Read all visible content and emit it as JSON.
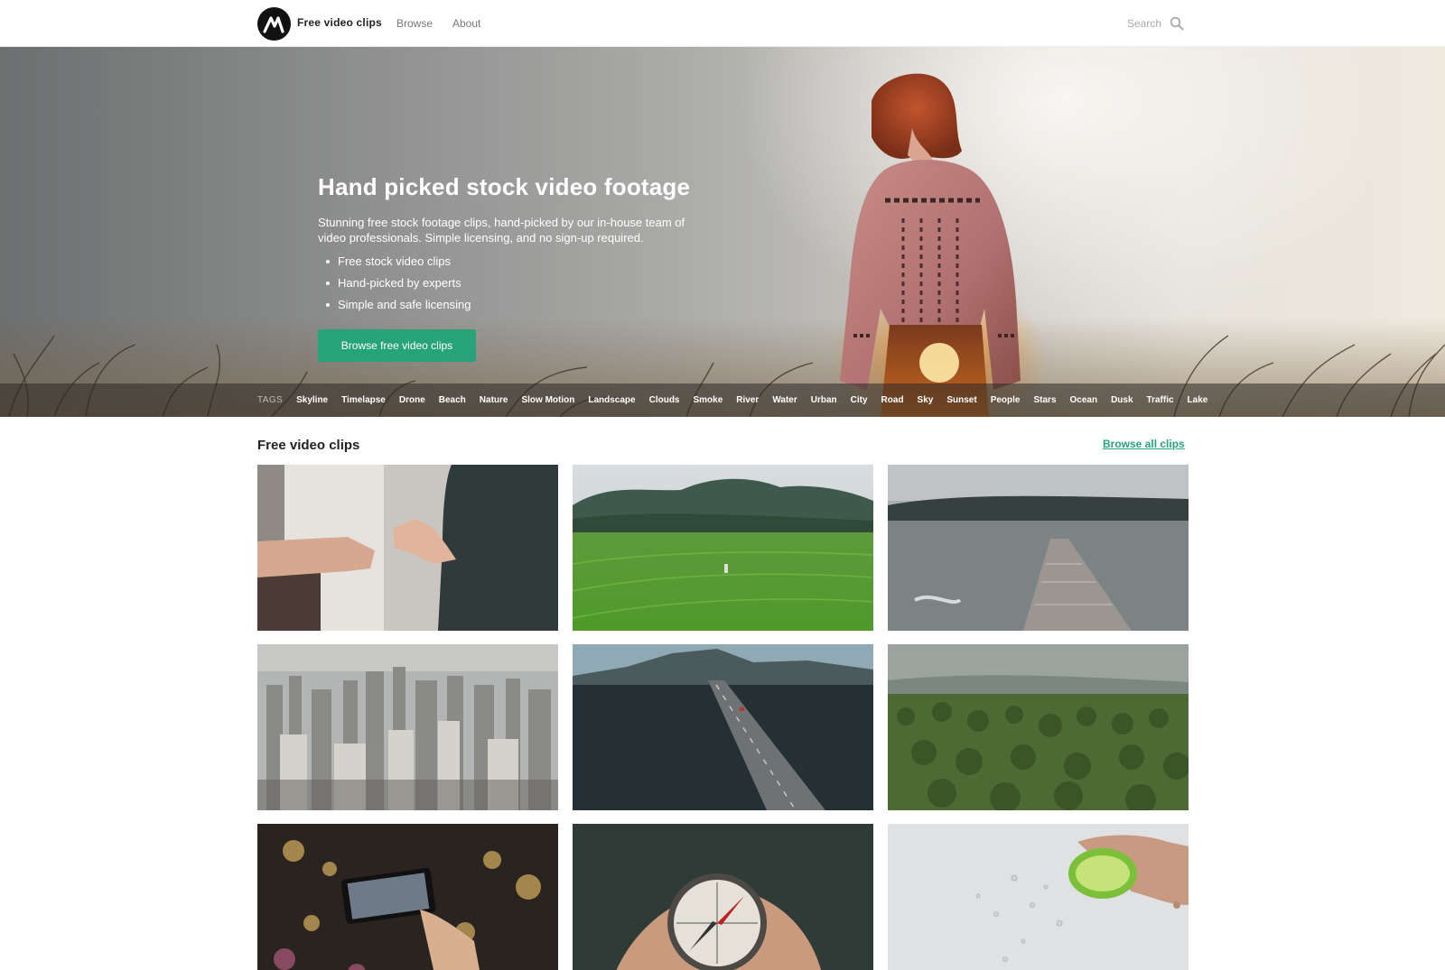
{
  "header": {
    "brand": "Free video clips",
    "nav": [
      {
        "label": "Browse"
      },
      {
        "label": "About"
      }
    ],
    "search_placeholder": "Search"
  },
  "hero": {
    "title": "Hand picked stock video footage",
    "description": "Stunning free stock footage clips, hand-picked by our in-house team of video professionals. Simple licensing, and no sign-up required.",
    "bullets": [
      "Free stock video clips",
      "Hand-picked by experts",
      "Simple and safe licensing"
    ],
    "cta_label": "Browse free video clips"
  },
  "tags": {
    "label": "TAGS",
    "items": [
      "Skyline",
      "Timelapse",
      "Drone",
      "Beach",
      "Nature",
      "Slow Motion",
      "Landscape",
      "Clouds",
      "Smoke",
      "River",
      "Water",
      "Urban",
      "City",
      "Road",
      "Sky",
      "Sunset",
      "People",
      "Stars",
      "Ocean",
      "Dusk",
      "Traffic",
      "Lake"
    ]
  },
  "clips": {
    "title": "Free video clips",
    "browse_all_label": "Browse all clips"
  },
  "colors": {
    "accent": "#27a37a",
    "header_bg": "#ffffff",
    "tags_bar": "rgba(40,40,40,0.55)"
  }
}
